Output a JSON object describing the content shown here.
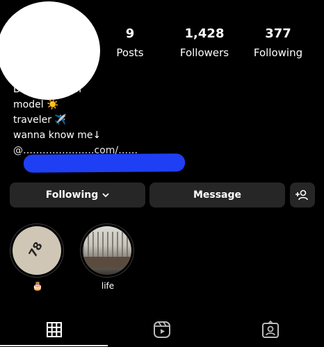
{
  "profile": {
    "stats": {
      "posts": {
        "value": "9",
        "label": "Posts"
      },
      "followers": {
        "value": "1,428",
        "label": "Followers"
      },
      "following": {
        "value": "377",
        "label": "Following"
      }
    },
    "bio": {
      "category": "Digital creator",
      "lines": [
        "model ☀️",
        "traveler ✈️",
        "wanna know me↓"
      ],
      "link": "@………………….com/……"
    }
  },
  "actions": {
    "following_label": "Following",
    "message_label": "Message"
  },
  "highlights": [
    {
      "caption": "🎂",
      "cover_text": "78"
    },
    {
      "caption": "life"
    }
  ],
  "tabs": {
    "active": "grid",
    "items": [
      "grid-icon",
      "reels-icon",
      "tagged-icon"
    ]
  }
}
